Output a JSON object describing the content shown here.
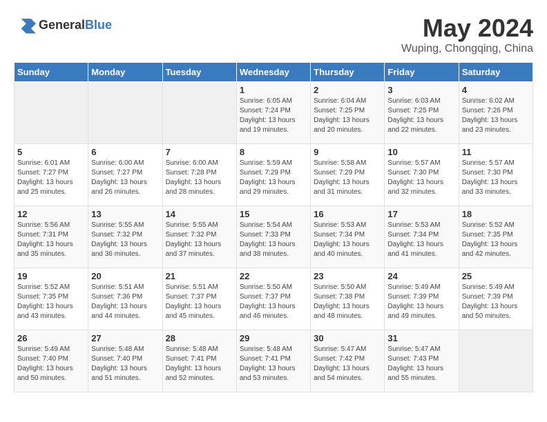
{
  "header": {
    "logo_general": "General",
    "logo_blue": "Blue",
    "title": "May 2024",
    "subtitle": "Wuping, Chongqing, China"
  },
  "calendar": {
    "days_of_week": [
      "Sunday",
      "Monday",
      "Tuesday",
      "Wednesday",
      "Thursday",
      "Friday",
      "Saturday"
    ],
    "weeks": [
      [
        {
          "day": "",
          "info": ""
        },
        {
          "day": "",
          "info": ""
        },
        {
          "day": "",
          "info": ""
        },
        {
          "day": "1",
          "info": "Sunrise: 6:05 AM\nSunset: 7:24 PM\nDaylight: 13 hours\nand 19 minutes."
        },
        {
          "day": "2",
          "info": "Sunrise: 6:04 AM\nSunset: 7:25 PM\nDaylight: 13 hours\nand 20 minutes."
        },
        {
          "day": "3",
          "info": "Sunrise: 6:03 AM\nSunset: 7:25 PM\nDaylight: 13 hours\nand 22 minutes."
        },
        {
          "day": "4",
          "info": "Sunrise: 6:02 AM\nSunset: 7:26 PM\nDaylight: 13 hours\nand 23 minutes."
        }
      ],
      [
        {
          "day": "5",
          "info": "Sunrise: 6:01 AM\nSunset: 7:27 PM\nDaylight: 13 hours\nand 25 minutes."
        },
        {
          "day": "6",
          "info": "Sunrise: 6:00 AM\nSunset: 7:27 PM\nDaylight: 13 hours\nand 26 minutes."
        },
        {
          "day": "7",
          "info": "Sunrise: 6:00 AM\nSunset: 7:28 PM\nDaylight: 13 hours\nand 28 minutes."
        },
        {
          "day": "8",
          "info": "Sunrise: 5:59 AM\nSunset: 7:29 PM\nDaylight: 13 hours\nand 29 minutes."
        },
        {
          "day": "9",
          "info": "Sunrise: 5:58 AM\nSunset: 7:29 PM\nDaylight: 13 hours\nand 31 minutes."
        },
        {
          "day": "10",
          "info": "Sunrise: 5:57 AM\nSunset: 7:30 PM\nDaylight: 13 hours\nand 32 minutes."
        },
        {
          "day": "11",
          "info": "Sunrise: 5:57 AM\nSunset: 7:30 PM\nDaylight: 13 hours\nand 33 minutes."
        }
      ],
      [
        {
          "day": "12",
          "info": "Sunrise: 5:56 AM\nSunset: 7:31 PM\nDaylight: 13 hours\nand 35 minutes."
        },
        {
          "day": "13",
          "info": "Sunrise: 5:55 AM\nSunset: 7:32 PM\nDaylight: 13 hours\nand 36 minutes."
        },
        {
          "day": "14",
          "info": "Sunrise: 5:55 AM\nSunset: 7:32 PM\nDaylight: 13 hours\nand 37 minutes."
        },
        {
          "day": "15",
          "info": "Sunrise: 5:54 AM\nSunset: 7:33 PM\nDaylight: 13 hours\nand 38 minutes."
        },
        {
          "day": "16",
          "info": "Sunrise: 5:53 AM\nSunset: 7:34 PM\nDaylight: 13 hours\nand 40 minutes."
        },
        {
          "day": "17",
          "info": "Sunrise: 5:53 AM\nSunset: 7:34 PM\nDaylight: 13 hours\nand 41 minutes."
        },
        {
          "day": "18",
          "info": "Sunrise: 5:52 AM\nSunset: 7:35 PM\nDaylight: 13 hours\nand 42 minutes."
        }
      ],
      [
        {
          "day": "19",
          "info": "Sunrise: 5:52 AM\nSunset: 7:35 PM\nDaylight: 13 hours\nand 43 minutes."
        },
        {
          "day": "20",
          "info": "Sunrise: 5:51 AM\nSunset: 7:36 PM\nDaylight: 13 hours\nand 44 minutes."
        },
        {
          "day": "21",
          "info": "Sunrise: 5:51 AM\nSunset: 7:37 PM\nDaylight: 13 hours\nand 45 minutes."
        },
        {
          "day": "22",
          "info": "Sunrise: 5:50 AM\nSunset: 7:37 PM\nDaylight: 13 hours\nand 46 minutes."
        },
        {
          "day": "23",
          "info": "Sunrise: 5:50 AM\nSunset: 7:38 PM\nDaylight: 13 hours\nand 48 minutes."
        },
        {
          "day": "24",
          "info": "Sunrise: 5:49 AM\nSunset: 7:39 PM\nDaylight: 13 hours\nand 49 minutes."
        },
        {
          "day": "25",
          "info": "Sunrise: 5:49 AM\nSunset: 7:39 PM\nDaylight: 13 hours\nand 50 minutes."
        }
      ],
      [
        {
          "day": "26",
          "info": "Sunrise: 5:49 AM\nSunset: 7:40 PM\nDaylight: 13 hours\nand 50 minutes."
        },
        {
          "day": "27",
          "info": "Sunrise: 5:48 AM\nSunset: 7:40 PM\nDaylight: 13 hours\nand 51 minutes."
        },
        {
          "day": "28",
          "info": "Sunrise: 5:48 AM\nSunset: 7:41 PM\nDaylight: 13 hours\nand 52 minutes."
        },
        {
          "day": "29",
          "info": "Sunrise: 5:48 AM\nSunset: 7:41 PM\nDaylight: 13 hours\nand 53 minutes."
        },
        {
          "day": "30",
          "info": "Sunrise: 5:47 AM\nSunset: 7:42 PM\nDaylight: 13 hours\nand 54 minutes."
        },
        {
          "day": "31",
          "info": "Sunrise: 5:47 AM\nSunset: 7:43 PM\nDaylight: 13 hours\nand 55 minutes."
        },
        {
          "day": "",
          "info": ""
        }
      ]
    ]
  }
}
